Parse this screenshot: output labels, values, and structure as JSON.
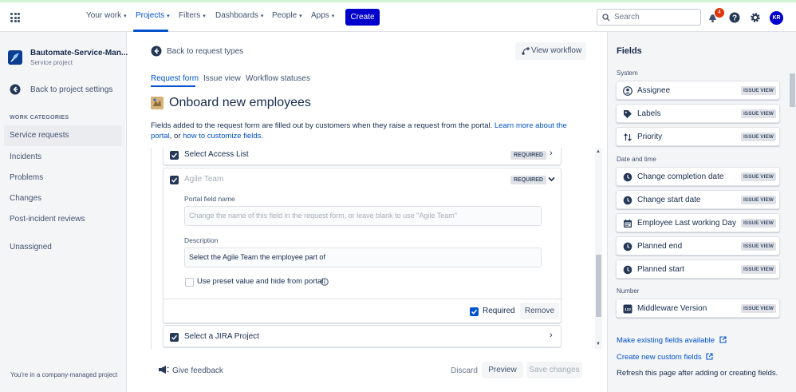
{
  "colors": {
    "brand": "#0000cc",
    "link": "#0052cc",
    "badge": "#de350b"
  },
  "topnav": {
    "items": [
      {
        "label": "Your work"
      },
      {
        "label": "Projects"
      },
      {
        "label": "Filters"
      },
      {
        "label": "Dashboards"
      },
      {
        "label": "People"
      },
      {
        "label": "Apps"
      }
    ],
    "create_label": "Create",
    "search_placeholder": "Search",
    "notification_count": "4",
    "avatar_initials": "KR"
  },
  "sidebar": {
    "project_name": "Bautomate-Service-Man...",
    "project_type": "Service project",
    "back_label": "Back to project settings",
    "categories_title": "WORK CATEGORIES",
    "items": [
      {
        "label": "Service requests"
      },
      {
        "label": "Incidents"
      },
      {
        "label": "Problems"
      },
      {
        "label": "Changes"
      },
      {
        "label": "Post-incident reviews"
      },
      {
        "label": "Unassigned"
      }
    ],
    "footer": "You're in a company-managed project"
  },
  "main": {
    "back_label": "Back to request types",
    "view_workflow": "View workflow",
    "tabs": [
      {
        "label": "Request form"
      },
      {
        "label": "Issue view"
      },
      {
        "label": "Workflow statuses"
      }
    ],
    "title": "Onboard new employees",
    "desc_text": "Fields added to the request form are filled out by customers when they raise a request from the portal.",
    "desc_link1": "Learn more about the portal",
    "desc_or": ", or",
    "desc_link2": "how to customize fields",
    "desc_end": ".",
    "form": {
      "field1": {
        "label": "Select Access List",
        "badge": "REQUIRED"
      },
      "field2": {
        "label": "Agile Team",
        "badge": "REQUIRED",
        "portal_name_label": "Portal field name",
        "portal_name_placeholder": "Change the name of this field in the request form, or leave blank to use \"Agile Team\"",
        "description_label": "Description",
        "description_value": "Select the Agile Team the employee part of",
        "preset_label": "Use preset value and hide from portal",
        "required_label": "Required",
        "remove_label": "Remove"
      },
      "field3": {
        "label": "Select a JIRA Project"
      }
    },
    "feedback_label": "Give feedback",
    "discard_label": "Discard",
    "preview_label": "Preview",
    "save_label": "Save changes"
  },
  "fields_panel": {
    "title": "Fields",
    "section_system": "System",
    "system": [
      {
        "label": "Assignee",
        "badge": "ISSUE VIEW",
        "icon": "person-icon"
      },
      {
        "label": "Labels",
        "badge": "ISSUE VIEW",
        "icon": "tag-icon"
      },
      {
        "label": "Priority",
        "badge": "ISSUE VIEW",
        "icon": "priority-icon"
      }
    ],
    "section_datetime": "Date and time",
    "datetime": [
      {
        "label": "Change completion date",
        "badge": "ISSUE VIEW",
        "icon": "clock-icon"
      },
      {
        "label": "Change start date",
        "badge": "ISSUE VIEW",
        "icon": "clock-icon"
      },
      {
        "label": "Employee Last working Day",
        "badge": "ISSUE VIEW",
        "icon": "calendar-icon"
      },
      {
        "label": "Planned end",
        "badge": "ISSUE VIEW",
        "icon": "clock-icon"
      },
      {
        "label": "Planned start",
        "badge": "ISSUE VIEW",
        "icon": "clock-icon"
      }
    ],
    "section_number": "Number",
    "number": [
      {
        "label": "Middleware Version",
        "badge": "ISSUE VIEW",
        "icon": "number-icon",
        "icon_text": "123"
      }
    ],
    "link_existing": "Make existing fields available",
    "link_create": "Create new custom fields",
    "refresh_text": "Refresh this page after adding or creating fields."
  }
}
